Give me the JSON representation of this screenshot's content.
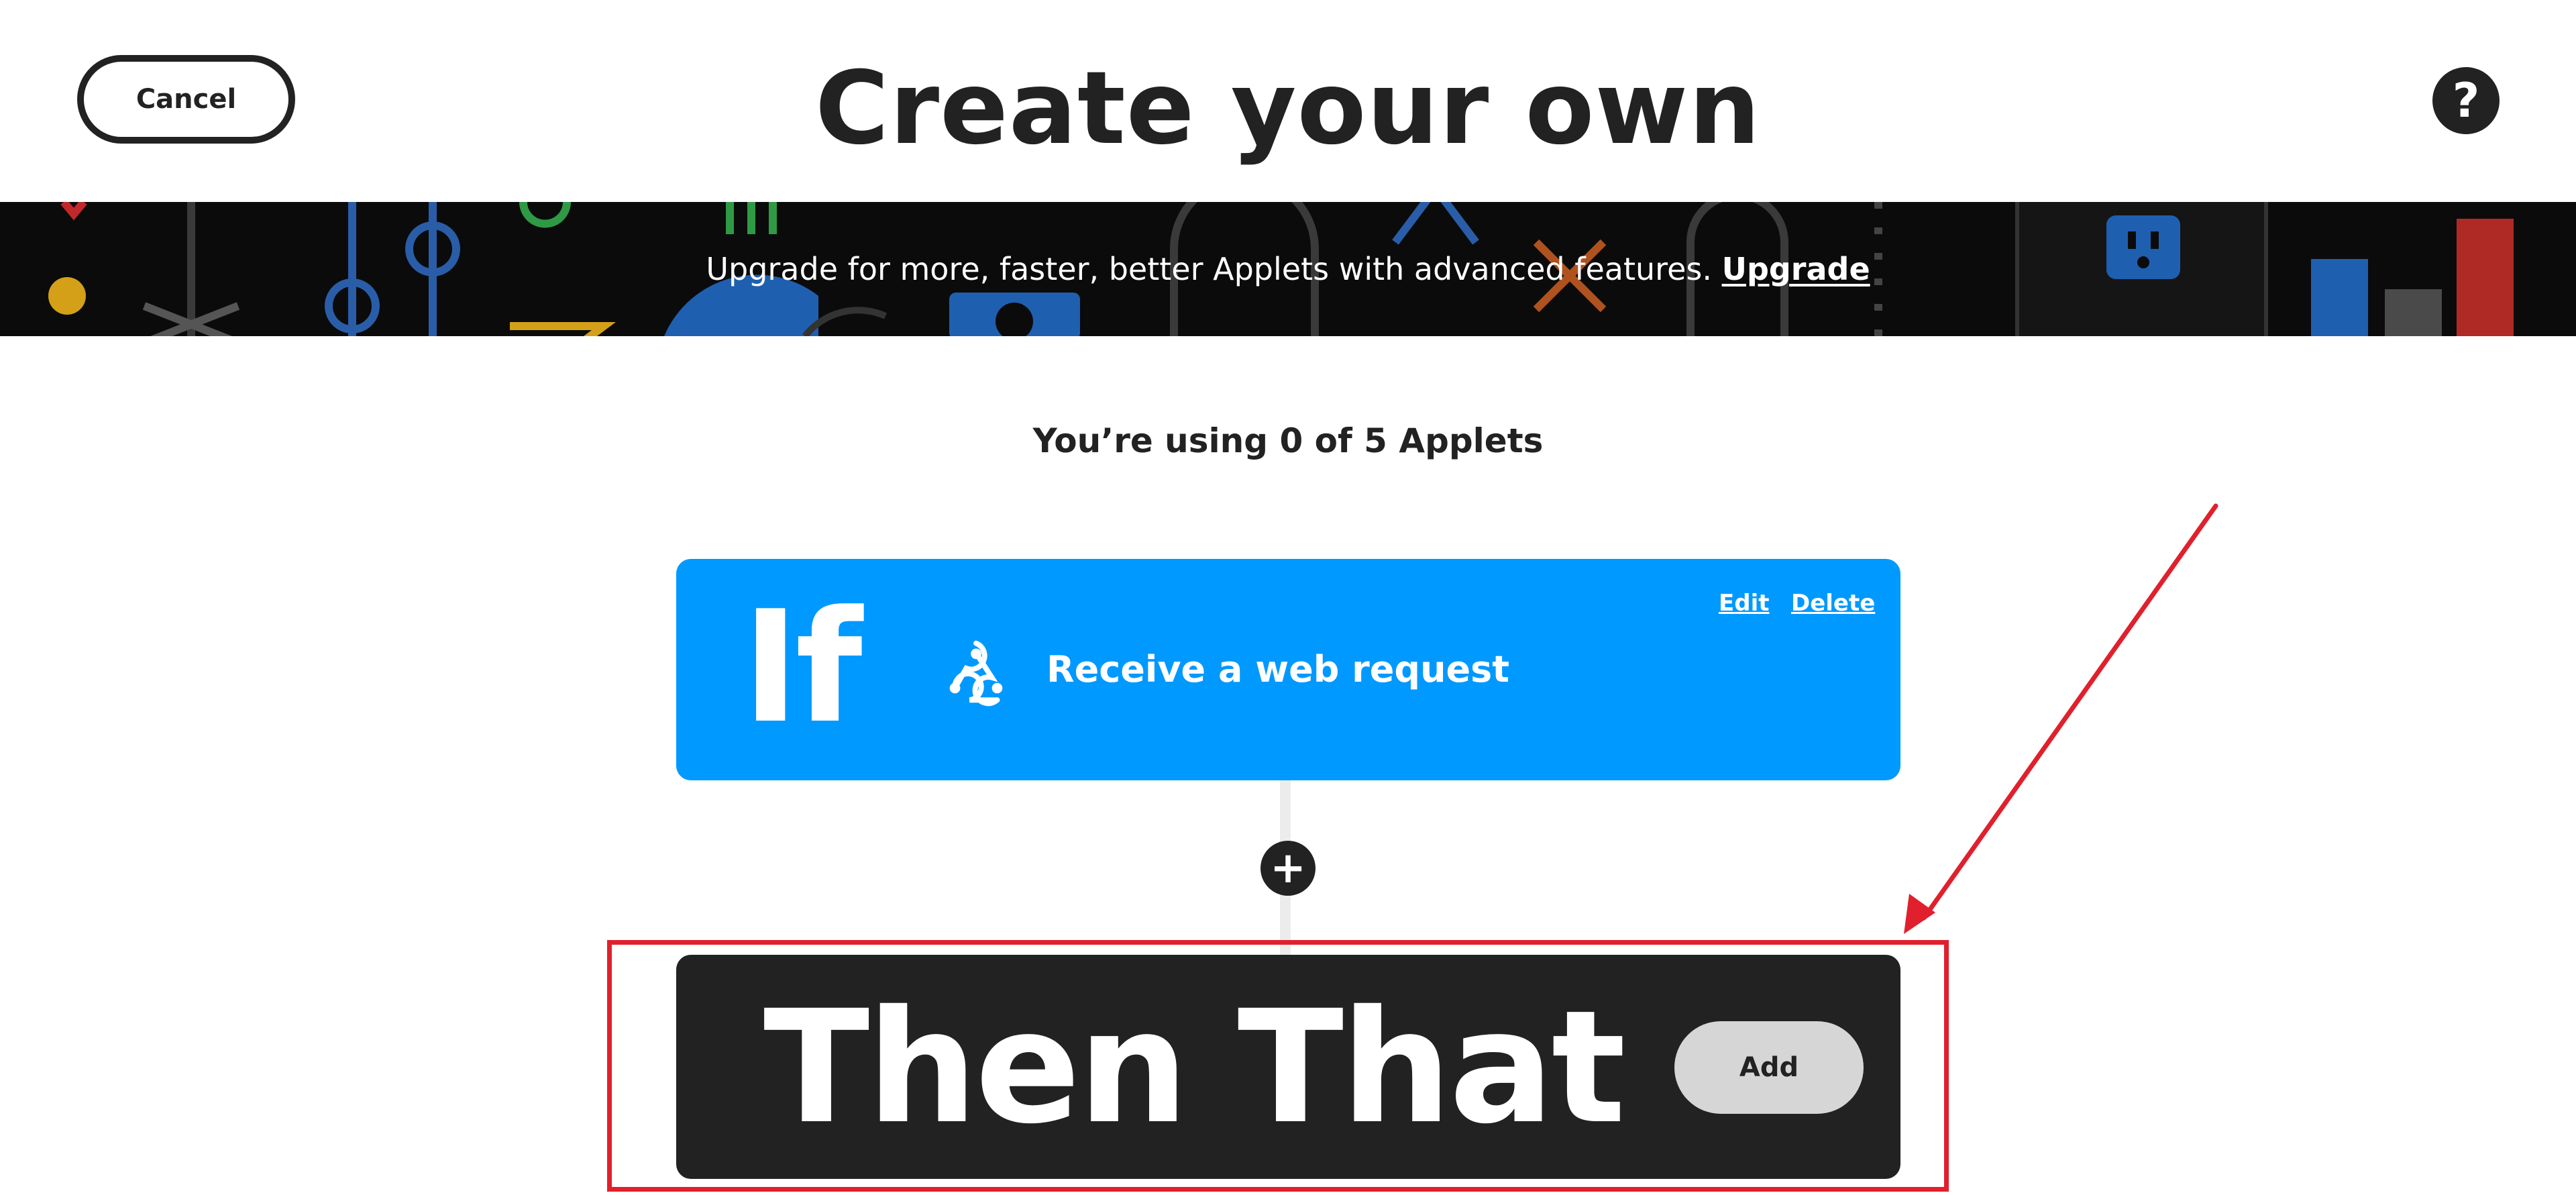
{
  "header": {
    "cancel_label": "Cancel",
    "title": "Create your own",
    "help_symbol": "?"
  },
  "banner": {
    "text": "Upgrade for more, faster, better Applets with advanced features.",
    "link_label": "Upgrade"
  },
  "usage": {
    "text": "You’re using 0 of 5 Applets"
  },
  "if_card": {
    "label": "If",
    "icon": "webhook-icon",
    "trigger": "Receive a web request",
    "edit_label": "Edit",
    "delete_label": "Delete",
    "color": "#0099ff"
  },
  "connector": {
    "add_step_symbol": "+"
  },
  "then_card": {
    "label": "Then That",
    "add_label": "Add",
    "color": "#222222"
  },
  "annotation": {
    "highlight_color": "#e0202c"
  }
}
